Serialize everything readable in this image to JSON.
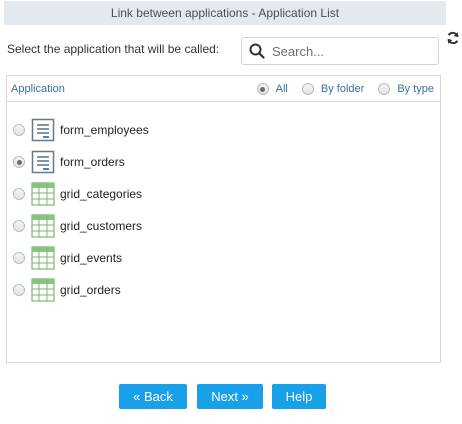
{
  "window": {
    "title": "Link between applications - Application List"
  },
  "prompt": "Select the application that will be called:",
  "search": {
    "placeholder": "Search..."
  },
  "panel": {
    "column": "Application",
    "filters": [
      {
        "label": "All",
        "selected": true
      },
      {
        "label": "By folder",
        "selected": false
      },
      {
        "label": "By type",
        "selected": false
      }
    ]
  },
  "apps": [
    {
      "name": "form_employees",
      "type": "form-icon",
      "selected": false
    },
    {
      "name": "form_orders",
      "type": "form-icon",
      "selected": true
    },
    {
      "name": "grid_categories",
      "type": "grid-icon",
      "selected": false
    },
    {
      "name": "grid_customers",
      "type": "grid-icon",
      "selected": false
    },
    {
      "name": "grid_events",
      "type": "grid-icon",
      "selected": false
    },
    {
      "name": "grid_orders",
      "type": "grid-icon",
      "selected": false
    }
  ],
  "buttons": {
    "back": "« Back",
    "next": "Next »",
    "help": "Help"
  },
  "colors": {
    "accent": "#18a0e8",
    "link": "#3a6f9e",
    "titlebar": "#e4e8ef"
  }
}
